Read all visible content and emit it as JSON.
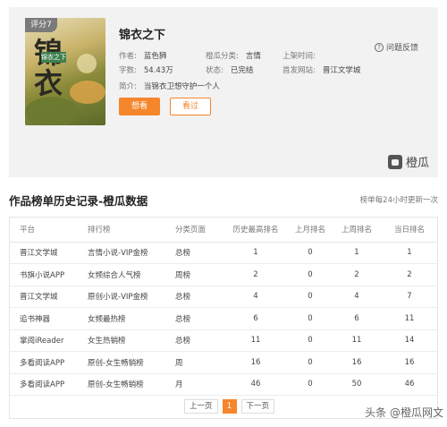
{
  "book": {
    "score": "评分7",
    "cover_text": "锦衣之下",
    "cover_badge": "锦衣之下",
    "title": "锦衣之下",
    "author_label": "作者:",
    "author": "蓝色狮",
    "category_label": "橙瓜分类:",
    "category": "言情",
    "shelf_time_label": "上架时间:",
    "shelf_time": "",
    "words_label": "字数:",
    "words": "54.43万",
    "status_label": "状态:",
    "status": "已完结",
    "site_label": "首发网站:",
    "site": "晋江文学城",
    "intro_label": "简介:",
    "intro": "当锦衣卫想守护一个人",
    "btn_want": "想看",
    "btn_read": "看过",
    "feedback": "问题反馈",
    "brand": "橙瓜"
  },
  "section": {
    "title": "作品榜单历史记录-橙瓜数据",
    "note": "榜单每24小时更新一次"
  },
  "table": {
    "headers": [
      "平台",
      "排行榜",
      "分类页面",
      "历史最高排名",
      "上月排名",
      "上周排名",
      "当日排名"
    ],
    "rows": [
      [
        "晋江文学城",
        "言情小说-VIP金榜",
        "总榜",
        "1",
        "0",
        "1",
        "1"
      ],
      [
        "书旗小说APP",
        "女频综合人气榜",
        "周榜",
        "2",
        "0",
        "2",
        "2"
      ],
      [
        "晋江文学城",
        "原创小说-VIP金榜",
        "总榜",
        "4",
        "0",
        "4",
        "7"
      ],
      [
        "追书神器",
        "女频最热榜",
        "总榜",
        "6",
        "0",
        "6",
        "11"
      ],
      [
        "掌阅iReader",
        "女生热销榜",
        "总榜",
        "11",
        "0",
        "11",
        "14"
      ],
      [
        "多看阅读APP",
        "原创-女生畅销榜",
        "周",
        "16",
        "0",
        "16",
        "16"
      ],
      [
        "多看阅读APP",
        "原创-女生畅销榜",
        "月",
        "46",
        "0",
        "50",
        "46"
      ]
    ]
  },
  "pager": {
    "prev": "上一页",
    "current": "1",
    "next": "下一页"
  },
  "watermark": "头条 @橙瓜网文"
}
